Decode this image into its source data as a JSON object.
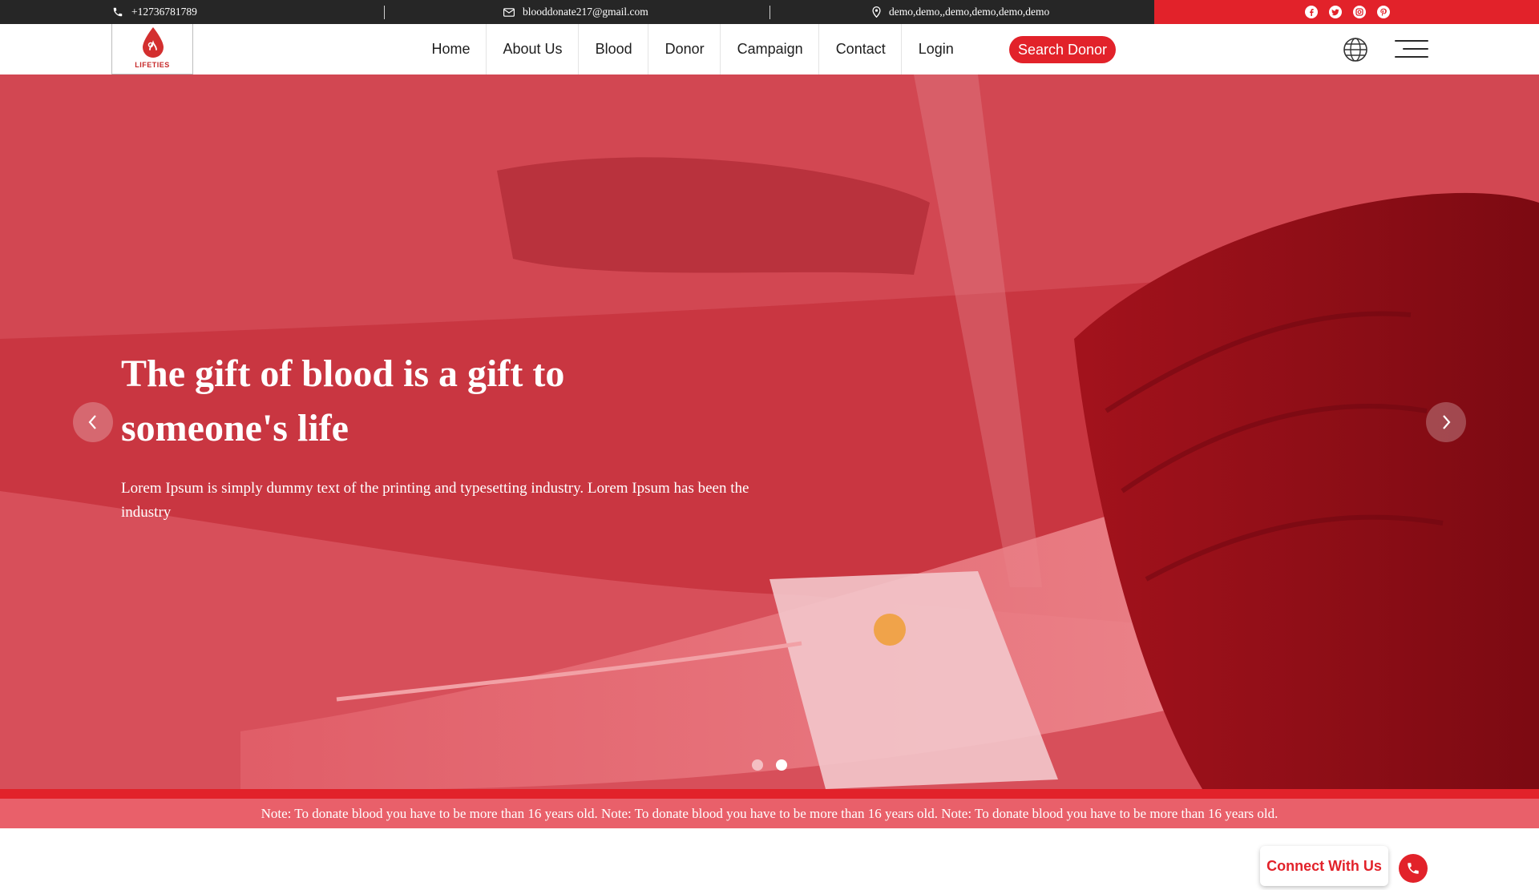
{
  "topbar": {
    "phone": "+12736781789",
    "email": "blooddonate217@gmail.com",
    "address": "demo,demo,,demo,demo,demo,demo",
    "social_icons": [
      "facebook-icon",
      "twitter-icon",
      "instagram-icon",
      "pinterest-icon"
    ]
  },
  "logo": {
    "text": "LIFETIES"
  },
  "nav": {
    "items": [
      "Home",
      "About Us",
      "Blood",
      "Donor",
      "Campaign",
      "Contact",
      "Login"
    ],
    "search_button": "Search Donor"
  },
  "hero": {
    "title": "The gift of blood is a gift to someone's life",
    "subtitle": "Lorem Ipsum is simply dummy text of the printing and typesetting industry. Lorem Ipsum has been the industry",
    "slide_count": 2,
    "active_slide": 2
  },
  "note": {
    "text": "Note: To donate blood you have to be more than 16 years old. Note: To donate blood you have to be more than 16 years old. Note: To donate blood you have to be more than 16 years old."
  },
  "connect": {
    "label": "Connect With Us"
  },
  "colors": {
    "brand_red": "#e2222a",
    "topbar_dark": "#262626",
    "note_bg": "#e9606a"
  }
}
